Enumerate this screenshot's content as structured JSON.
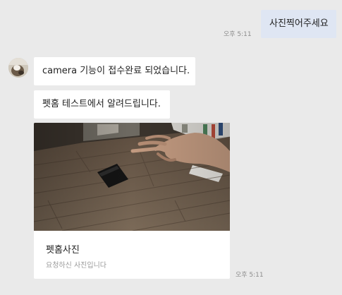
{
  "messages": {
    "outgoing": {
      "text": "사진찍어주세요",
      "time": "오후 5:11"
    },
    "incoming_1": {
      "text": "camera 기능이 접수완료 되었습니다."
    },
    "incoming_2": {
      "text": "펫홈 테스트에서 알려드립니다."
    },
    "card": {
      "title": "펫홈사진",
      "subtitle": "요청하신 사진입니다",
      "time": "오후 5:11"
    }
  },
  "colors": {
    "background": "#eaeaea",
    "incoming_bubble": "#ffffff",
    "outgoing_bubble": "#dfe6f3"
  }
}
